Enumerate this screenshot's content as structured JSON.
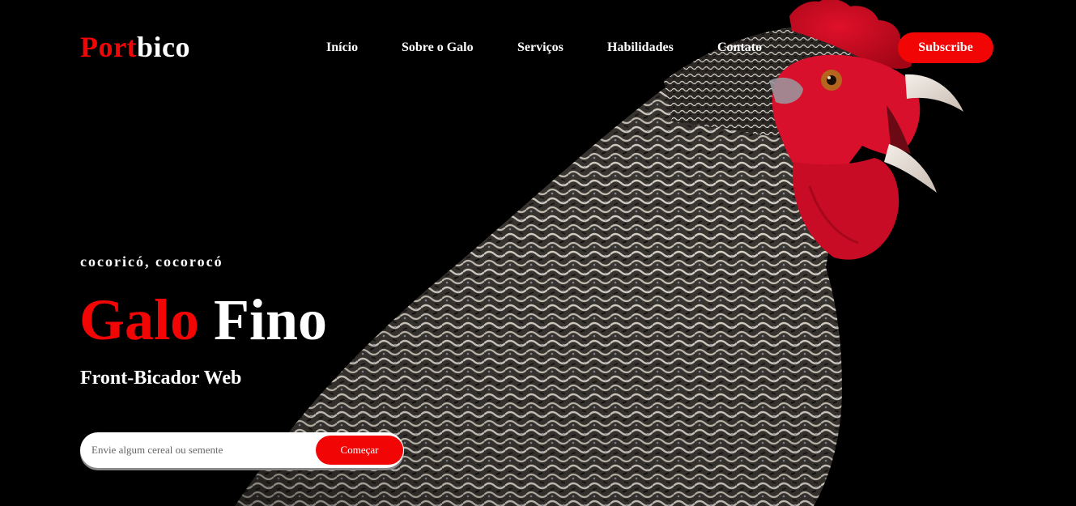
{
  "header": {
    "logo_accent": "Port",
    "logo_rest": "bico",
    "nav": [
      "Início",
      "Sobre o Galo",
      "Serviços",
      "Habilidades",
      "Contato"
    ],
    "subscribe_label": "Subscribe"
  },
  "hero": {
    "tagline": "cocoricó, cocorocó",
    "title_accent": "Galo",
    "title_rest": "Fino",
    "subtitle": "Front-Bicador Web",
    "input_placeholder": "Envie algum cereal ou semente",
    "cta_label": "Começar",
    "image_subject": "rooster-photo"
  },
  "colors": {
    "accent": "#f20505",
    "background": "#000000",
    "text": "#ffffff"
  }
}
